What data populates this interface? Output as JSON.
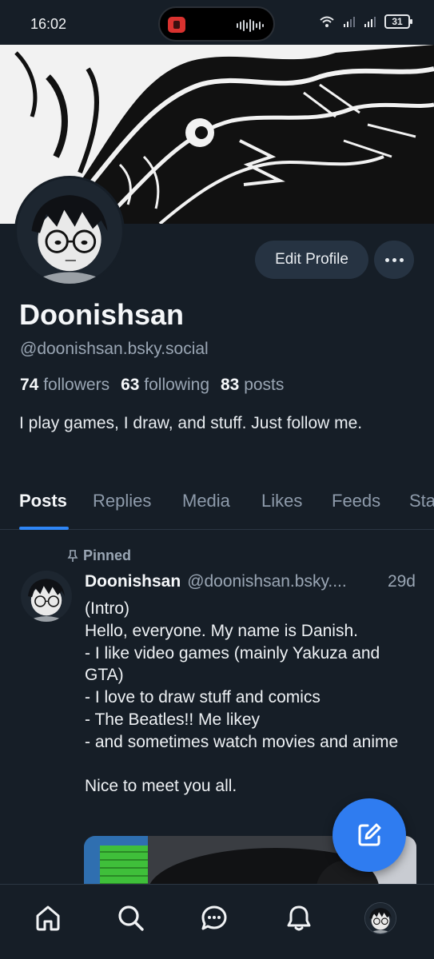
{
  "status_bar": {
    "time": "16:02",
    "battery": "31",
    "icons": [
      "record-app-icon",
      "audio-wave-icon",
      "wifi-icon",
      "signal-icon",
      "signal-icon",
      "battery-icon"
    ]
  },
  "profile": {
    "display_name": "Doonishsan",
    "handle": "@doonishsan.bsky.social",
    "followers_count": "74",
    "followers_label": "followers",
    "following_count": "63",
    "following_label": "following",
    "posts_count": "83",
    "posts_label": "posts",
    "bio": "I play games, I draw, and stuff. Just follow me.",
    "edit_button_label": "Edit Profile"
  },
  "tabs": [
    {
      "label": "Posts",
      "active": true
    },
    {
      "label": "Replies"
    },
    {
      "label": "Media"
    },
    {
      "label": "Likes"
    },
    {
      "label": "Feeds"
    },
    {
      "label": "Starter Packs"
    }
  ],
  "post": {
    "pinned_label": "Pinned",
    "author": "Doonishsan",
    "handle": "@doonishsan.bsky....",
    "time": "29d",
    "text": "(Intro)\nHello, everyone. My name is Danish.\n- I like video games (mainly Yakuza and GTA)\n- I love to draw stuff and comics\n- The Beatles!! Me likey\n- and sometimes watch movies and anime\n\nNice to meet you all."
  },
  "bottom_nav": [
    "home-icon",
    "search-icon",
    "chat-icon",
    "notifications-icon",
    "profile-avatar"
  ],
  "colors": {
    "background": "#161e27",
    "accent": "#2f86f6",
    "fab": "#2f7cf0",
    "secondary_text": "#9aa6b4"
  }
}
